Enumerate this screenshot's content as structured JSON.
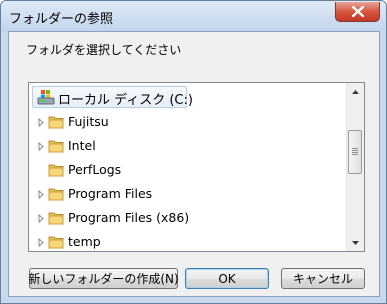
{
  "window": {
    "title": "フォルダーの参照",
    "close_icon": "close-icon"
  },
  "prompt": "フォルダを選択してください",
  "tree": {
    "items": [
      {
        "label": "ローカル ディスク (C:)",
        "icon": "local-disk-icon",
        "expander": "none",
        "selected": true
      },
      {
        "label": "Fujitsu",
        "icon": "folder-icon",
        "expander": "collapsed"
      },
      {
        "label": "Intel",
        "icon": "folder-icon",
        "expander": "collapsed"
      },
      {
        "label": "PerfLogs",
        "icon": "folder-icon",
        "expander": "none"
      },
      {
        "label": "Program Files",
        "icon": "folder-icon",
        "expander": "collapsed"
      },
      {
        "label": "Program Files (x86)",
        "icon": "folder-icon",
        "expander": "collapsed"
      },
      {
        "label": "temp",
        "icon": "folder-icon",
        "expander": "collapsed"
      }
    ]
  },
  "buttons": {
    "new_folder": "新しいフォルダーの作成(N)",
    "ok": "OK",
    "cancel": "キャンセル"
  }
}
